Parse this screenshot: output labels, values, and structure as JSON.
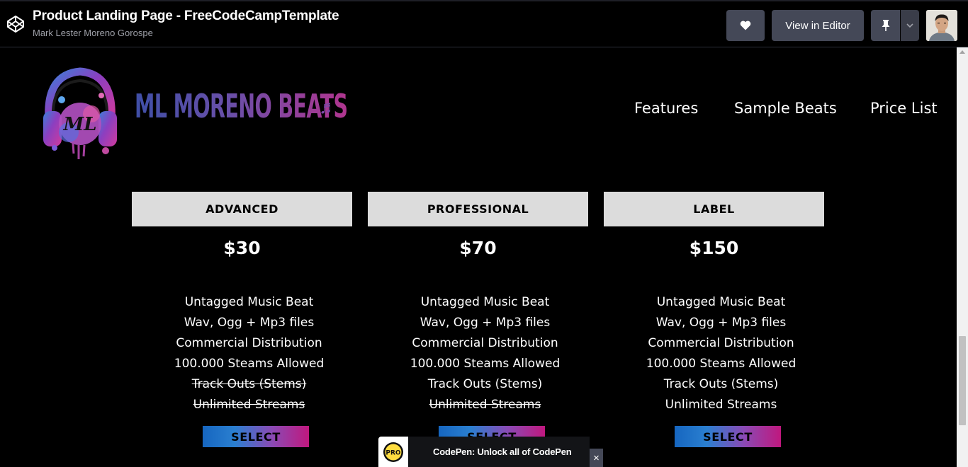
{
  "pen": {
    "title": "Product Landing Page - FreeCodeCampTemplate",
    "author": "Mark Lester Moreno Gorospe",
    "view_in_editor": "View in Editor"
  },
  "site": {
    "brand": "ML MORENO BEATS",
    "brand_note": "♬",
    "nav": [
      "Features",
      "Sample Beats",
      "Price List"
    ]
  },
  "plans": [
    {
      "name": "ADVANCED",
      "price": "$30",
      "features": [
        {
          "text": "Untagged Music Beat",
          "included": true
        },
        {
          "text": "Wav, Ogg + Mp3 files",
          "included": true
        },
        {
          "text": "Commercial Distribution",
          "included": true
        },
        {
          "text": "100.000 Steams Allowed",
          "included": true
        },
        {
          "text": "Track Outs (Stems)",
          "included": false
        },
        {
          "text": "Unlimited Streams",
          "included": false
        }
      ],
      "button": "SELECT"
    },
    {
      "name": "PROFESSIONAL",
      "price": "$70",
      "features": [
        {
          "text": "Untagged Music Beat",
          "included": true
        },
        {
          "text": "Wav, Ogg + Mp3 files",
          "included": true
        },
        {
          "text": "Commercial Distribution",
          "included": true
        },
        {
          "text": "100.000 Steams Allowed",
          "included": true
        },
        {
          "text": "Track Outs (Stems)",
          "included": true
        },
        {
          "text": "Unlimited Streams",
          "included": false
        }
      ],
      "button": "SELECT"
    },
    {
      "name": "LABEL",
      "price": "$150",
      "features": [
        {
          "text": "Untagged Music Beat",
          "included": true
        },
        {
          "text": "Wav, Ogg + Mp3 files",
          "included": true
        },
        {
          "text": "Commercial Distribution",
          "included": true
        },
        {
          "text": "100.000 Steams Allowed",
          "included": true
        },
        {
          "text": "Track Outs (Stems)",
          "included": true
        },
        {
          "text": "Unlimited Streams",
          "included": true
        }
      ],
      "button": "SELECT"
    }
  ],
  "promo": {
    "badge": "PRO",
    "text": "CodePen: Unlock all of CodePen",
    "close": "×"
  },
  "icons": {
    "logo": "codepen-logo-icon",
    "heart": "heart-icon",
    "pin": "pin-icon",
    "dropdown": "chevron-down-icon",
    "headphones": "headphones-logo-icon"
  },
  "colors": {
    "button_bg": "#444857",
    "card_header": "#dcdcdc",
    "gradient_start": "#1666c0",
    "gradient_end": "#c0187e"
  }
}
